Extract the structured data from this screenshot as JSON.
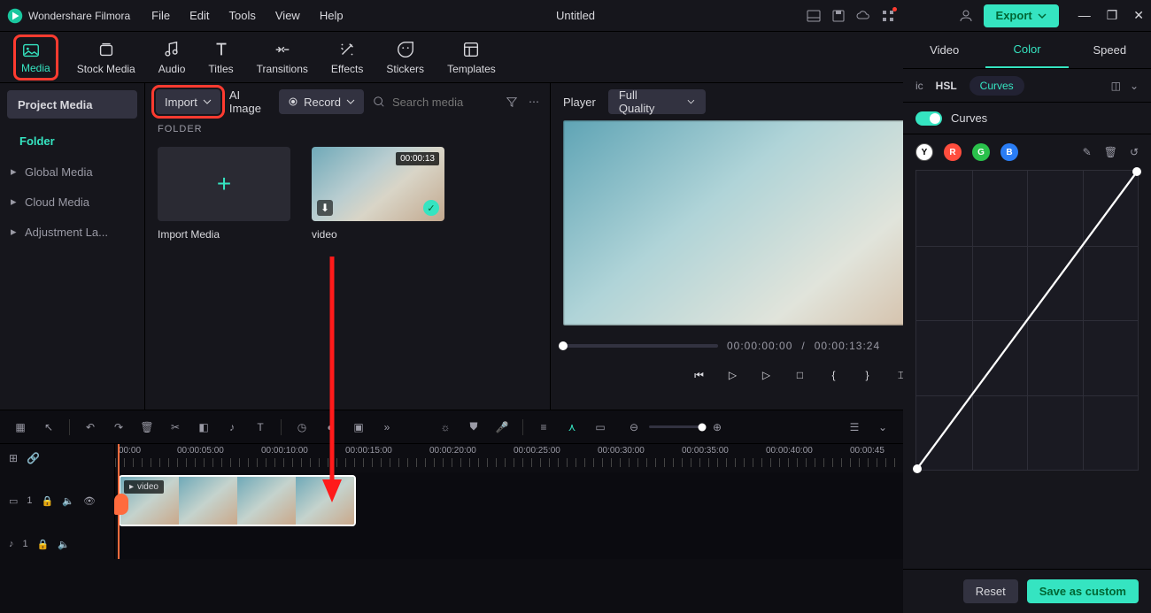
{
  "app": {
    "name": "Wondershare Filmora"
  },
  "menu": [
    "File",
    "Edit",
    "Tools",
    "View",
    "Help"
  ],
  "document": "Untitled",
  "export": "Export",
  "tooltabs": [
    {
      "id": "media",
      "label": "Media",
      "active": true
    },
    {
      "id": "stock",
      "label": "Stock Media"
    },
    {
      "id": "audio",
      "label": "Audio"
    },
    {
      "id": "titles",
      "label": "Titles"
    },
    {
      "id": "transitions",
      "label": "Transitions"
    },
    {
      "id": "effects",
      "label": "Effects"
    },
    {
      "id": "stickers",
      "label": "Stickers"
    },
    {
      "id": "templates",
      "label": "Templates"
    }
  ],
  "sidebar": {
    "head": "Project Media",
    "folder": "Folder",
    "items": [
      "Global Media",
      "Cloud Media",
      "Adjustment La..."
    ]
  },
  "mediabar": {
    "import": "Import",
    "ai_image": "AI Image",
    "record": "Record",
    "search_placeholder": "Search media"
  },
  "folder_header": "FOLDER",
  "thumbs": {
    "import_label": "Import Media",
    "video_label": "video",
    "video_duration": "00:00:13"
  },
  "player": {
    "label": "Player",
    "quality": "Full Quality",
    "time_cur": "00:00:00:00",
    "time_sep": "/",
    "time_total": "00:00:13:24"
  },
  "colorpanel": {
    "tabs": [
      "Video",
      "Color",
      "Speed"
    ],
    "active_tab": "Color",
    "sub": {
      "ic": "ic",
      "hsl": "HSL",
      "curves": "Curves"
    },
    "toggle_label": "Curves",
    "channels": [
      "Y",
      "R",
      "G",
      "B"
    ],
    "reset": "Reset",
    "save": "Save as custom"
  },
  "timeline": {
    "ruler": [
      "00:00",
      "00:00:05:00",
      "00:00:10:00",
      "00:00:15:00",
      "00:00:20:00",
      "00:00:25:00",
      "00:00:30:00",
      "00:00:35:00",
      "00:00:40:00",
      "00:00:45"
    ],
    "clip_label": "video",
    "video_track": "1",
    "audio_track": "1"
  }
}
